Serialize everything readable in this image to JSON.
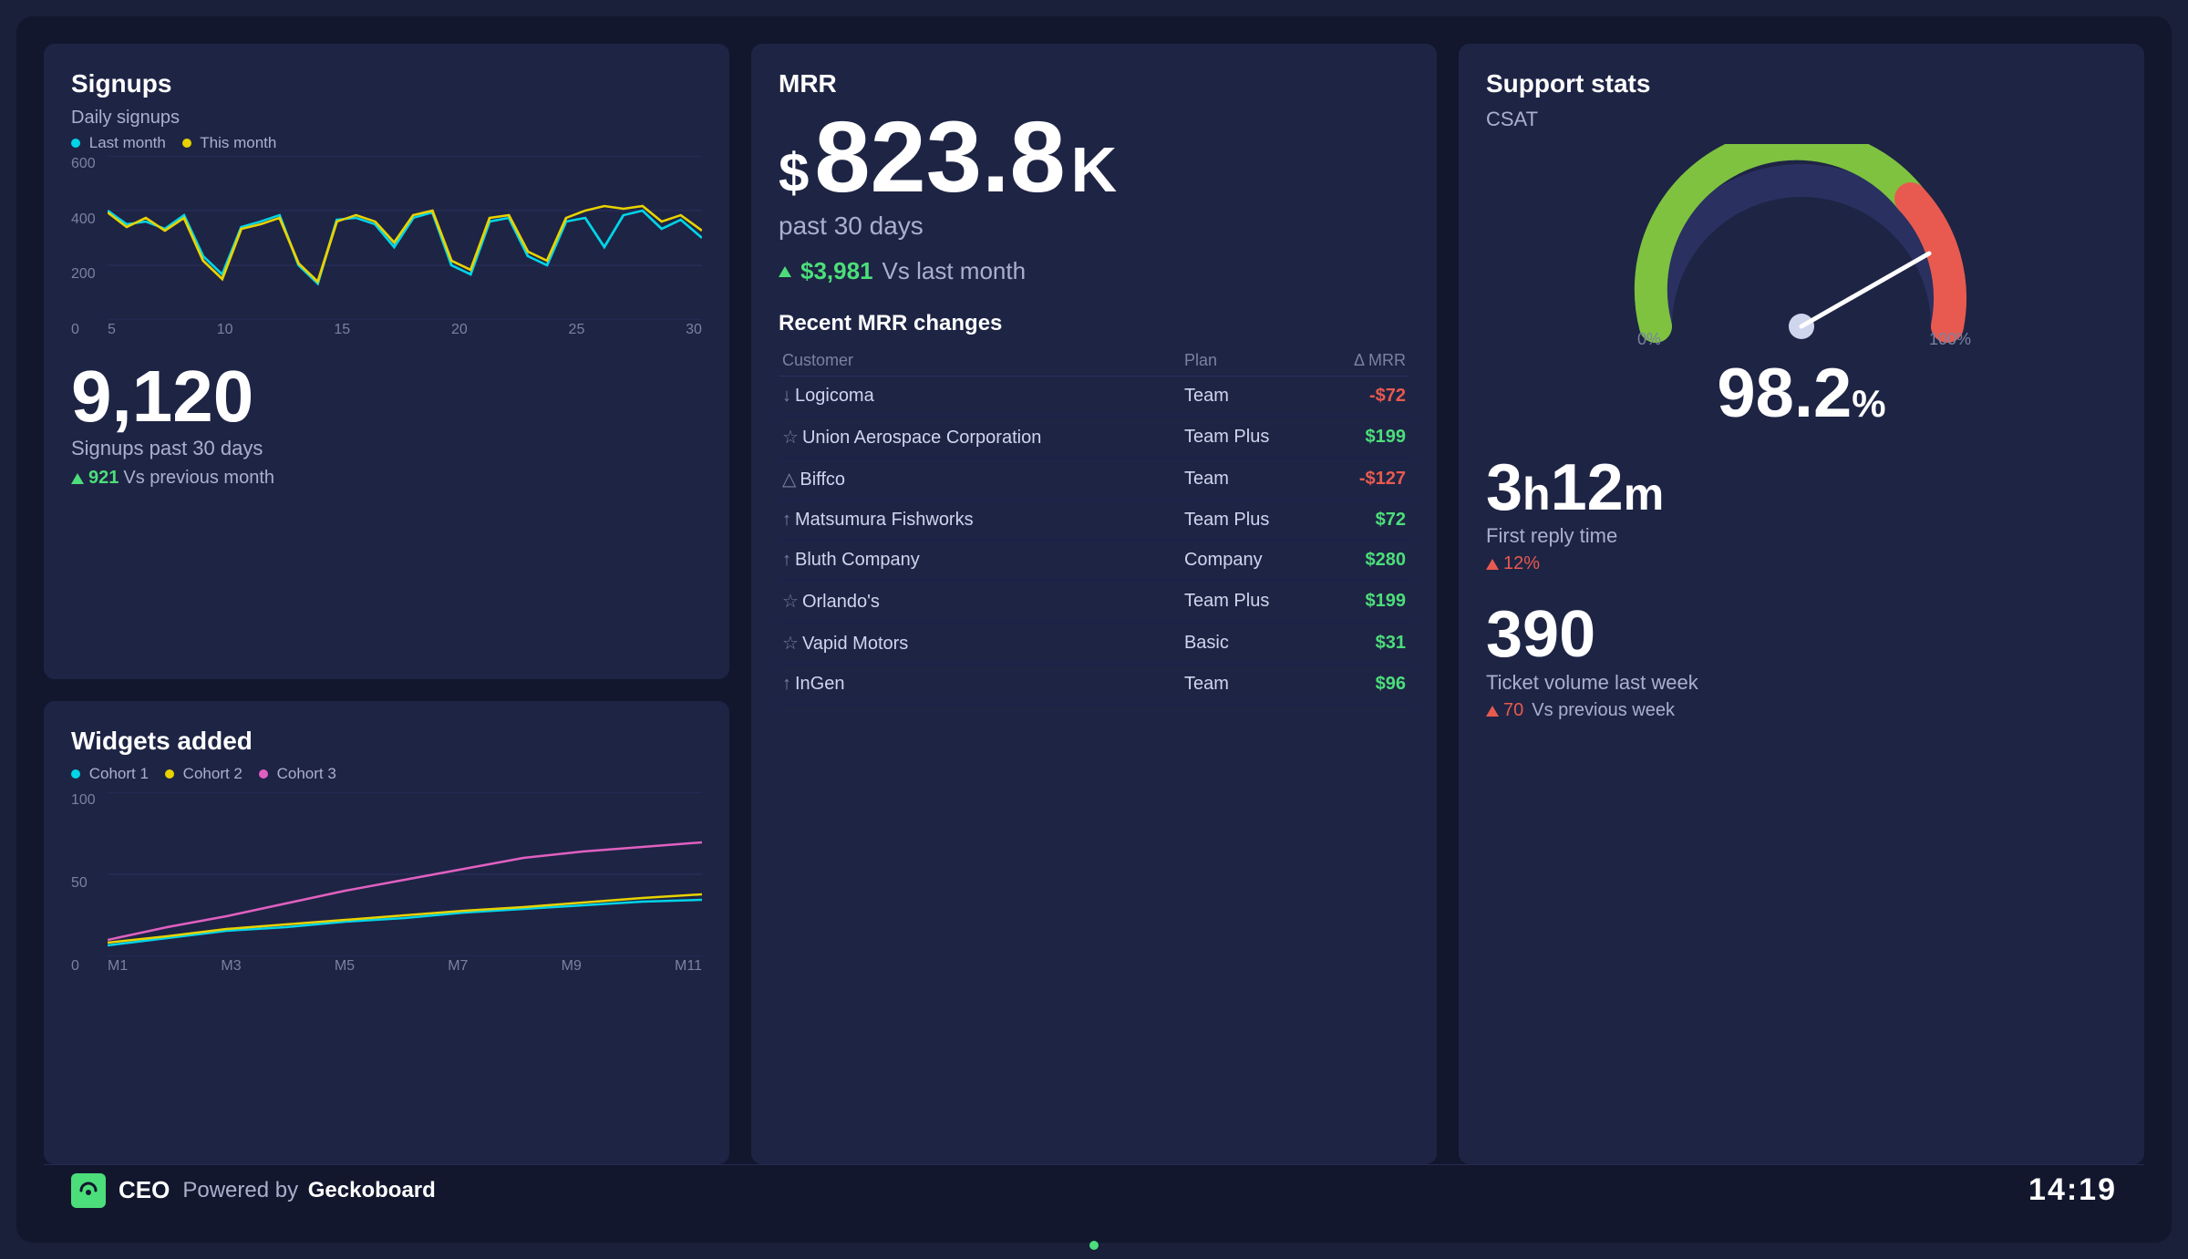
{
  "dashboard": {
    "background": "#12172e",
    "branding": {
      "brand": "CEO",
      "powered_by": "Powered by",
      "geckoboard": "Geckoboard",
      "clock": "14:19"
    }
  },
  "signups": {
    "title": "Signups",
    "chart_label": "Daily signups",
    "legend": [
      {
        "label": "Last month",
        "color": "#00d4e8"
      },
      {
        "label": "This month",
        "color": "#e8d200"
      }
    ],
    "y_labels": [
      "600",
      "400",
      "200",
      "0"
    ],
    "x_labels": [
      "5",
      "10",
      "15",
      "20",
      "25",
      "30"
    ],
    "big_number": "9,120",
    "big_label": "Signups past 30 days",
    "delta_value": "921",
    "delta_label": "Vs previous month"
  },
  "widgets": {
    "title": "Widgets added",
    "legend": [
      {
        "label": "Cohort 1",
        "color": "#00d4e8"
      },
      {
        "label": "Cohort 2",
        "color": "#e8d200"
      },
      {
        "label": "Cohort 3",
        "color": "#e060c0"
      }
    ],
    "y_labels": [
      "100",
      "50",
      "0"
    ],
    "x_labels": [
      "M1",
      "M3",
      "M5",
      "M7",
      "M9",
      "M11"
    ]
  },
  "mrr": {
    "title": "MRR",
    "amount": "823.8",
    "currency": "$",
    "suffix": "K",
    "period": "past 30 days",
    "delta_amount": "$3,981",
    "delta_label": "Vs last month",
    "section_title": "Recent MRR changes",
    "table_headers": [
      "Customer",
      "Plan",
      "Δ MRR"
    ],
    "rows": [
      {
        "icon": "down",
        "customer": "Logicoma",
        "plan": "Team",
        "delta": "-$72",
        "positive": false
      },
      {
        "icon": "star",
        "customer": "Union Aerospace Corporation",
        "plan": "Team Plus",
        "delta": "$199",
        "positive": true
      },
      {
        "icon": "triangle",
        "customer": "Biffco",
        "plan": "Team",
        "delta": "-$127",
        "positive": false
      },
      {
        "icon": "up",
        "customer": "Matsumura Fishworks",
        "plan": "Team Plus",
        "delta": "$72",
        "positive": true
      },
      {
        "icon": "up",
        "customer": "Bluth Company",
        "plan": "Company",
        "delta": "$280",
        "positive": true
      },
      {
        "icon": "star",
        "customer": "Orlando's",
        "plan": "Team Plus",
        "delta": "$199",
        "positive": true
      },
      {
        "icon": "star",
        "customer": "Vapid Motors",
        "plan": "Basic",
        "delta": "$31",
        "positive": true
      },
      {
        "icon": "up",
        "customer": "InGen",
        "plan": "Team",
        "delta": "$96",
        "positive": true
      }
    ]
  },
  "support": {
    "title": "Support stats",
    "csat_label": "CSAT",
    "gauge_min": "0%",
    "gauge_max": "100%",
    "csat_value": "98.2",
    "csat_unit": "%",
    "reply_time_h": "3",
    "reply_time_h_unit": "h",
    "reply_time_m": "12",
    "reply_time_m_unit": "m",
    "reply_label": "First reply time",
    "reply_delta": "12%",
    "reply_delta_type": "negative",
    "ticket_volume": "390",
    "ticket_label": "Ticket volume last week",
    "ticket_delta": "70",
    "ticket_delta_label": "Vs previous week",
    "ticket_delta_type": "negative"
  }
}
